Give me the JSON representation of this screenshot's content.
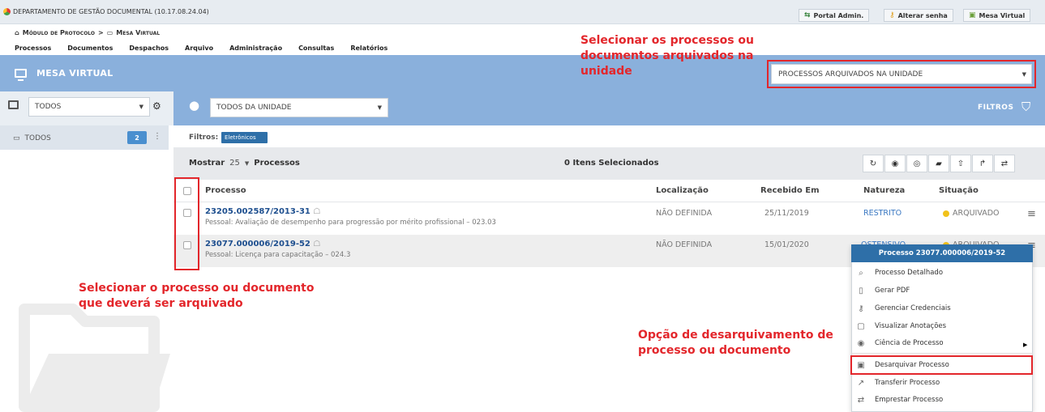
{
  "top_bar": {
    "department": "DEPARTAMENTO DE GESTÃO DOCUMENTAL (10.17.08.24.04)",
    "buttons": [
      {
        "label": "Portal Admin.",
        "icon": "portal-icon"
      },
      {
        "label": "Alterar senha",
        "icon": "key-icon"
      },
      {
        "label": "Mesa Virtual",
        "icon": "desk-icon"
      }
    ]
  },
  "breadcrumb": {
    "module": "Módulo de Protocolo",
    "separator": ">",
    "current": "Mesa Virtual"
  },
  "menu": [
    "Processos",
    "Documentos",
    "Despachos",
    "Arquivo",
    "Administração",
    "Consultas",
    "Relatórios"
  ],
  "header": {
    "title": "MESA VIRTUAL",
    "archive_select_value": "PROCESSOS ARQUIVADOS NA UNIDADE"
  },
  "filters": {
    "left_select_value": "TODOS",
    "unit_select_value": "TODOS DA UNIDADE",
    "filters_label": "FILTROS",
    "filters_prefix": "Filtros:",
    "active_filter": "Eletrônicos"
  },
  "sidebar": {
    "item_label": "TODOS",
    "count": "2"
  },
  "list_toolbar": {
    "show_label": "Mostrar",
    "page_size": "25",
    "items_label": "Processos",
    "selected_text": "0 Itens Selecionados"
  },
  "table": {
    "columns": [
      "Processo",
      "Localização",
      "Recebido Em",
      "Natureza",
      "Situação"
    ],
    "rows": [
      {
        "number": "23205.002587/2013-31",
        "description": "Pessoal: Avaliação de desempenho para progressão por mérito profissional – 023.03",
        "location": "NÃO DEFINIDA",
        "received": "25/11/2019",
        "nature": "RESTRITO",
        "status": "ARQUIVADO"
      },
      {
        "number": "23077.000006/2019-52",
        "description": "Pessoal: Licença para capacitação – 024.3",
        "location": "NÃO DEFINIDA",
        "received": "15/01/2020",
        "nature": "OSTENSIVO",
        "status": "ARQUIVADO"
      }
    ]
  },
  "context_menu": {
    "title": "Processo 23077.000006/2019-52",
    "items": [
      {
        "label": "Processo Detalhado",
        "icon": "search-icon"
      },
      {
        "label": "Gerar PDF",
        "icon": "pdf-icon"
      },
      {
        "label": "Gerenciar Credenciais",
        "icon": "user-key-icon"
      },
      {
        "label": "Visualizar Anotações",
        "icon": "note-icon"
      },
      {
        "label": "Ciência de Processo",
        "icon": "eye-icon"
      },
      {
        "label": "Desarquivar Processo",
        "icon": "unarchive-icon"
      },
      {
        "label": "Transferir Processo",
        "icon": "transfer-icon"
      },
      {
        "label": "Emprestar Processo",
        "icon": "lend-icon"
      }
    ]
  },
  "annotations": {
    "select_archived_1": "Selecionar os processos ou",
    "select_archived_2": "documentos arquivados na",
    "select_archived_3": "unidade",
    "select_process_1": "Selecionar o processo ou documento",
    "select_process_2": "que deverá ser arquivado",
    "unarchive_option_1": "Opção de desarquivamento de",
    "unarchive_option_2": "processo ou documento"
  },
  "colors": {
    "header_blue": "#8ab0dc",
    "link_blue": "#1e4f8f",
    "annotation_red": "#e3262b",
    "status_yellow": "#f1c21b"
  }
}
